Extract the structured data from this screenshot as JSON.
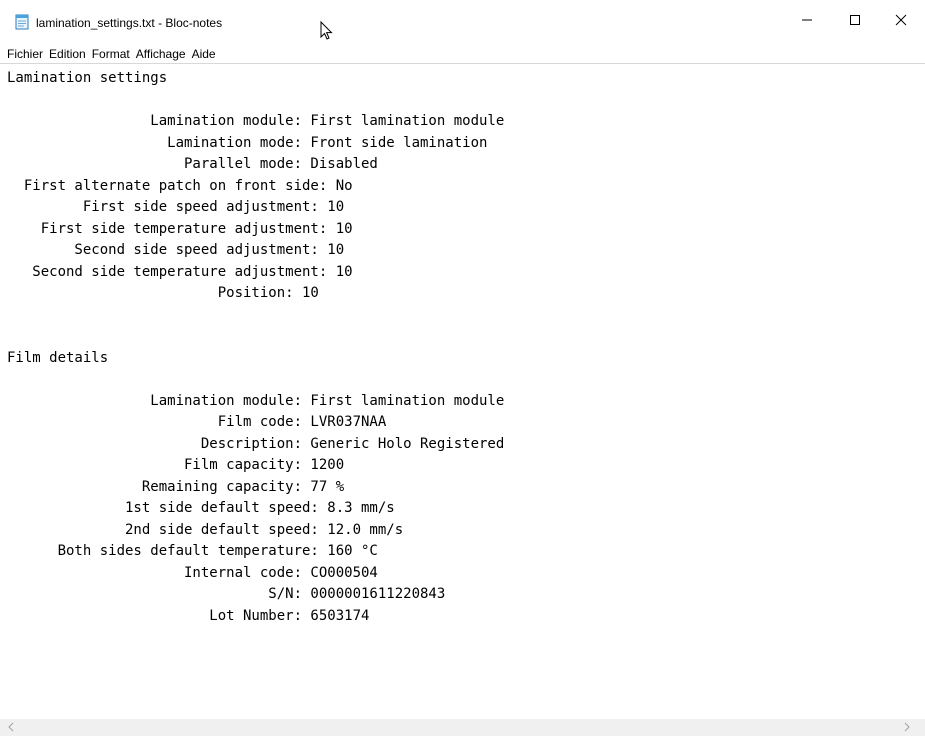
{
  "window": {
    "title": "lamination_settings.txt - Bloc-notes"
  },
  "menu": {
    "items": [
      "Fichier",
      "Edition",
      "Format",
      "Affichage",
      "Aide"
    ]
  },
  "document": {
    "content": "Lamination settings\n\n                 Lamination module: First lamination module\n                   Lamination mode: Front side lamination\n                     Parallel mode: Disabled\n  First alternate patch on front side: No\n         First side speed adjustment: 10\n    First side temperature adjustment: 10\n        Second side speed adjustment: 10\n   Second side temperature adjustment: 10\n                         Position: 10\n\n\nFilm details\n\n                 Lamination module: First lamination module\n                         Film code: LVR037NAA\n                       Description: Generic Holo Registered\n                     Film capacity: 1200\n                Remaining capacity: 77 %\n              1st side default speed: 8.3 mm/s\n              2nd side default speed: 12.0 mm/s\n      Both sides default temperature: 160 °C\n                     Internal code: CO000504\n                               S/N: 0000001611220843\n                        Lot Number: 6503174"
  },
  "icons": {
    "app": "notepad-icon",
    "cursor": "mouse-pointer-icon",
    "minimize": "minimize-icon",
    "maximize": "maximize-icon",
    "close": "close-icon",
    "scroll_left": "chevron-left-icon",
    "scroll_right": "chevron-right-icon"
  }
}
